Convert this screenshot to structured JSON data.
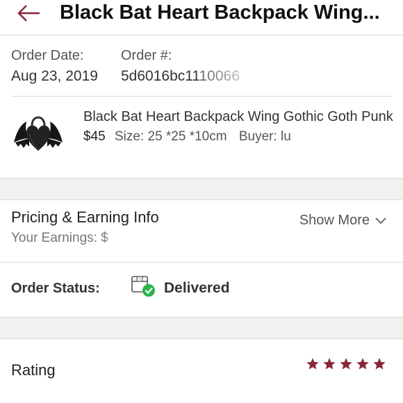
{
  "header": {
    "title": "Black Bat Heart Backpack Wing...",
    "back_icon": "back-arrow-icon",
    "accent_color": "#8a2736"
  },
  "order": {
    "date_label": "Order Date:",
    "date_value": "Aug 23, 2019",
    "number_label": "Order #:",
    "number_value": "5d6016bc1110066"
  },
  "product": {
    "title": "Black Bat Heart Backpack Wing Gothic Goth Punk",
    "price": "$45",
    "size": "Size: 25 *25 *10cm",
    "buyer": "Buyer: lu"
  },
  "pricing": {
    "title": "Pricing & Earning Info",
    "show_more": "Show More",
    "earnings_label": "Your Earnings: $"
  },
  "status": {
    "label": "Order Status:",
    "value": "Delivered",
    "icon": "package-delivered-icon",
    "check_color": "#2bb24c"
  },
  "rating": {
    "label": "Rating",
    "stars": 5,
    "star_color": "#8a2736"
  }
}
